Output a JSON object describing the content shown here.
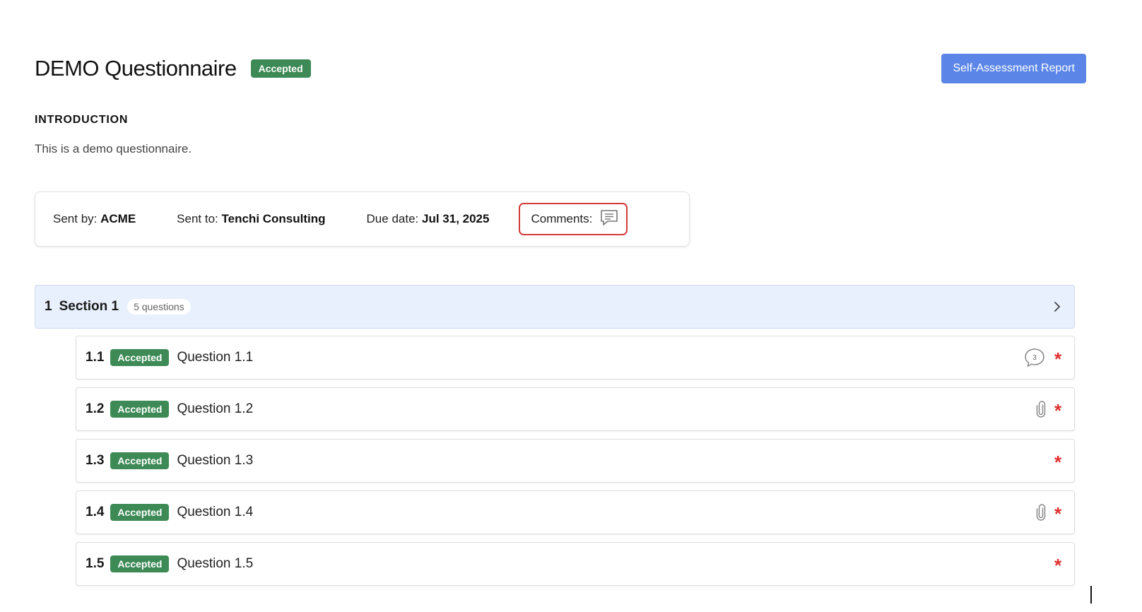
{
  "header": {
    "title": "DEMO Questionnaire",
    "status": "Accepted",
    "report_button": "Self-Assessment Report"
  },
  "introduction": {
    "heading": "INTRODUCTION",
    "text": "This is a demo questionnaire."
  },
  "meta": {
    "sent_by_label": "Sent by:",
    "sent_by": "ACME",
    "sent_to_label": "Sent to:",
    "sent_to": "Tenchi Consulting",
    "due_label": "Due date:",
    "due": "Jul 31, 2025",
    "comments_label": "Comments:"
  },
  "section": {
    "number": "1",
    "title": "Section 1",
    "count": "5 questions"
  },
  "questions": [
    {
      "number": "1.1",
      "status": "Accepted",
      "title": "Question 1.1",
      "comment_count": "3",
      "icon": "comment-count-icon",
      "required": "*"
    },
    {
      "number": "1.2",
      "status": "Accepted",
      "title": "Question 1.2",
      "icon": "paperclip-icon",
      "required": "*"
    },
    {
      "number": "1.3",
      "status": "Accepted",
      "title": "Question 1.3",
      "required": "*"
    },
    {
      "number": "1.4",
      "status": "Accepted",
      "title": "Question 1.4",
      "icon": "paperclip-icon",
      "required": "*"
    },
    {
      "number": "1.5",
      "status": "Accepted",
      "title": "Question 1.5",
      "required": "*"
    }
  ],
  "colors": {
    "accepted_badge": "#3d8a56",
    "primary_button": "#5b86e8",
    "section_background": "#e9f0fd",
    "required": "#e0302f",
    "comments_highlight": "#d23a3a"
  }
}
